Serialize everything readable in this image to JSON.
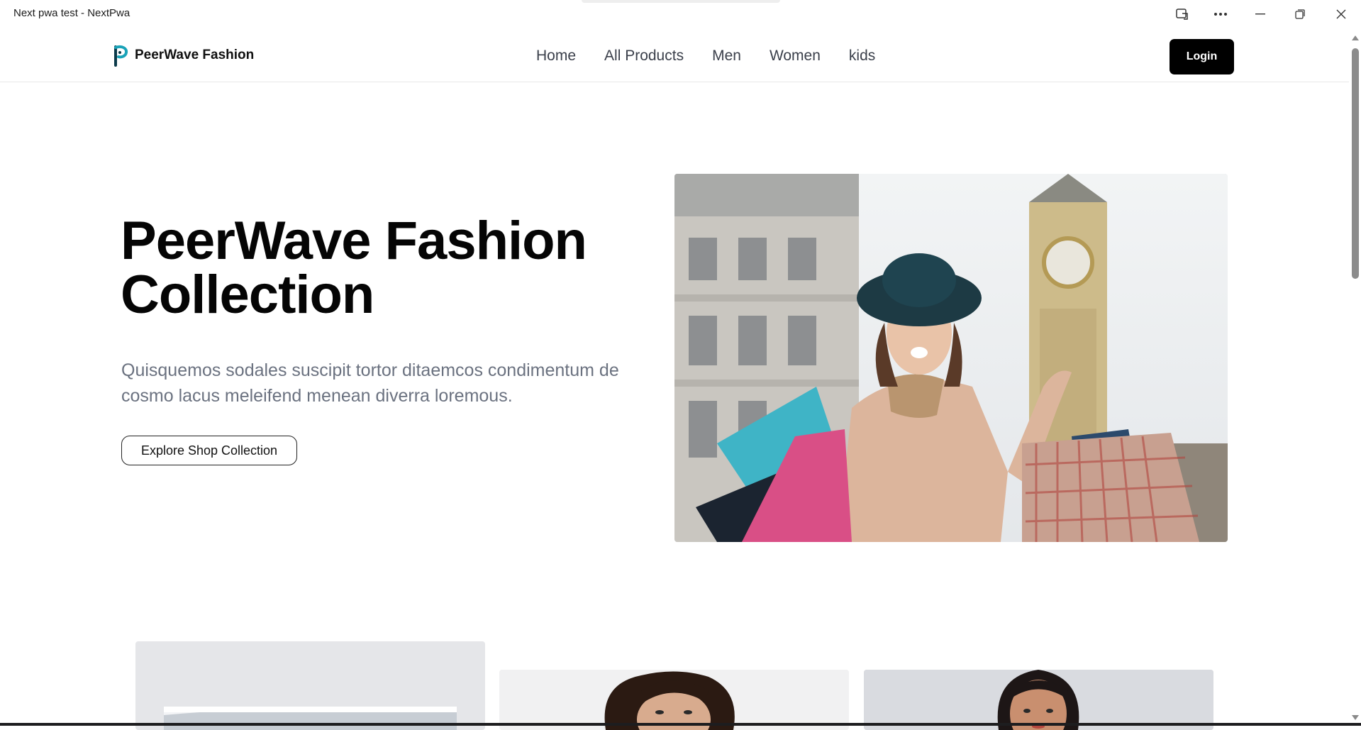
{
  "window": {
    "title": "Next pwa test - NextPwa",
    "controls": {
      "app_icon": "app-available-icon",
      "more": "more-icon",
      "minimize": "minimize-icon",
      "restore": "restore-icon",
      "close": "close-icon"
    }
  },
  "header": {
    "brand_name": "PeerWave Fashion",
    "logo_icon": "peerwave-logo-icon",
    "nav": [
      {
        "label": "Home"
      },
      {
        "label": "All Products"
      },
      {
        "label": "Men"
      },
      {
        "label": "Women"
      },
      {
        "label": "kids"
      }
    ],
    "login_label": "Login"
  },
  "hero": {
    "title_line1": "PeerWave Fashion",
    "title_line2": "Collection",
    "description": "Quisquemos sodales suscipit tortor ditaemcos condimentum de cosmo lacus meleifend menean diverra loremous.",
    "cta_label": "Explore Shop Collection",
    "image": "woman-shopping-bags-london-photo"
  },
  "categories": {
    "cards": [
      {
        "image": "category-photo-1"
      },
      {
        "image": "category-photo-man"
      },
      {
        "image": "category-photo-woman"
      }
    ]
  },
  "colors": {
    "primary": "#000000",
    "text_muted": "#6b7280",
    "nav_text": "#3a3f4a",
    "logo_teal": "#1aa3b8",
    "logo_dark": "#0c3a4a"
  }
}
